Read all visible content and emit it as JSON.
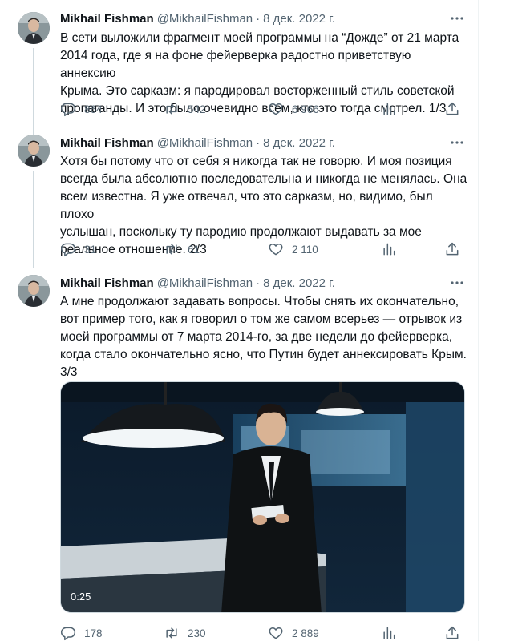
{
  "tweets": [
    {
      "author_name": "Mikhail Fishman",
      "author_handle": "@MikhailFishman",
      "separator": "·",
      "date": "8 дек. 2022 г.",
      "text": "В сети выложили фрагмент моей программы на “Дожде” от 21 марта\n2014 года, где я на фоне фейерверка радостно приветствую аннексию\nКрыма. Это сарказм: я пародировал восторженный стиль советской\nпропаганды. И это было очевидно всем, кто это тогда смотрел. 1/3",
      "replies": "864",
      "retweets": "542",
      "likes": "6 966",
      "views": ""
    },
    {
      "author_name": "Mikhail Fishman",
      "author_handle": "@MikhailFishman",
      "separator": "·",
      "date": "8 дек. 2022 г.",
      "text": "Хотя бы потому что от себя я никогда так не говорю. И моя позиция\nвсегда была абсолютно последовательна и никогда не менялась. Она\nвсем известна. Я уже отвечал, что это сарказм, но, видимо, был плохо\nуслышан, поскольку ту пародию продолжают выдавать за мое\nреальное отношение. 2/3",
      "replies": "31",
      "retweets": "61",
      "likes": "2 110",
      "views": ""
    },
    {
      "author_name": "Mikhail Fishman",
      "author_handle": "@MikhailFishman",
      "separator": "·",
      "date": "8 дек. 2022 г.",
      "text": "А мне продолжают задавать вопросы. Чтобы снять их окончательно,\nвот пример того, как я говорил о том же самом всерьез — отрывок из\nмоей программы от 7 марта 2014-го, за две недели до фейерверка,\nкогда стало окончательно ясно, что Путин будет аннексировать Крым.\n3/3",
      "video_duration": "0:25",
      "replies": "178",
      "retweets": "230",
      "likes": "2 889",
      "views": ""
    }
  ],
  "icons": {
    "more": "more-icon",
    "reply": "reply-icon",
    "retweet": "retweet-icon",
    "like": "heart-icon",
    "views": "views-icon",
    "share": "share-icon"
  },
  "colors": {
    "text": "#0f1419",
    "secondary": "#536471",
    "divider": "#eff3f4",
    "thread_line": "#cfd9de"
  }
}
